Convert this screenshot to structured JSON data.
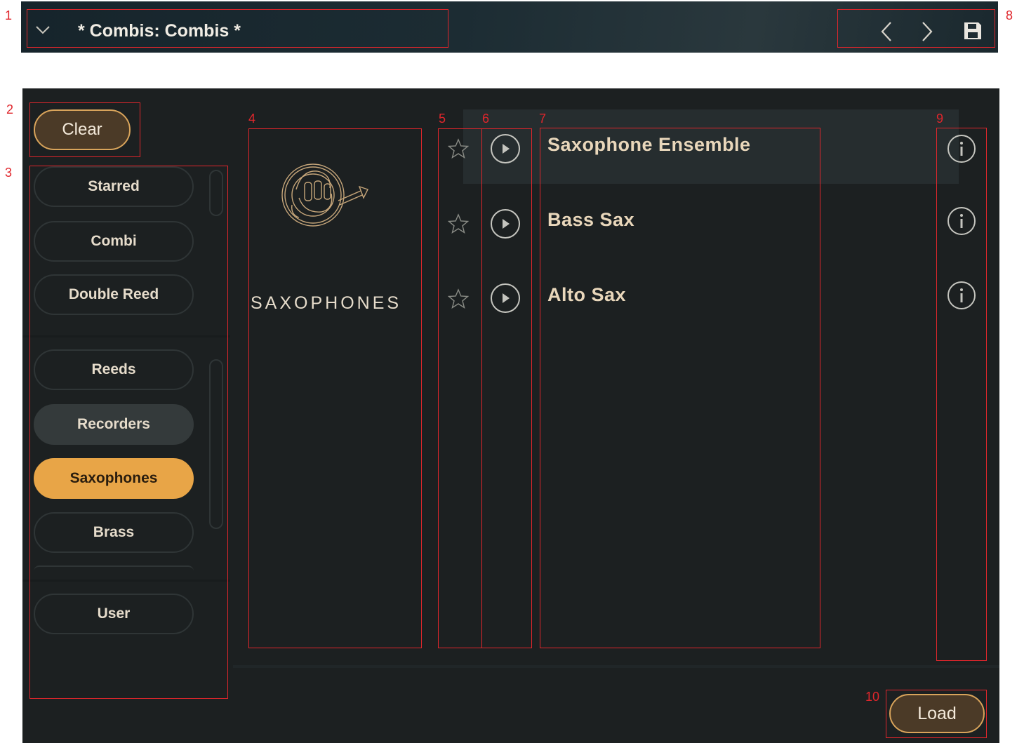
{
  "header": {
    "title": "* Combis: Combis *",
    "chevron_icon": "chevron-down-icon",
    "nav_prev_icon": "chevron-left-icon",
    "nav_next_icon": "chevron-right-icon",
    "save_icon": "floppy-disk-icon"
  },
  "toolbar": {
    "clear_label": "Clear"
  },
  "categories": {
    "top": [
      {
        "label": "Starred"
      },
      {
        "label": "Combi"
      },
      {
        "label": "Double Reed"
      }
    ],
    "groups": [
      {
        "label": "Reeds"
      },
      {
        "label": "Recorders"
      },
      {
        "label": "Saxophones"
      },
      {
        "label": "Brass"
      }
    ],
    "bottom": [
      {
        "label": "User"
      }
    ],
    "selected": "Saxophones"
  },
  "preview": {
    "title": "SAXOPHONES",
    "image_icon": "horn-icon"
  },
  "presets": [
    {
      "name": "Saxophone Ensemble"
    },
    {
      "name": "Bass Sax"
    },
    {
      "name": "Alto Sax"
    }
  ],
  "footer": {
    "load_label": "Load"
  },
  "callouts": [
    "1",
    "2",
    "3",
    "4",
    "5",
    "6",
    "7",
    "8",
    "9",
    "10"
  ],
  "colors": {
    "accent": "#e8a547",
    "panel_bg": "#1c2021",
    "text": "#e9d7bb",
    "annotation": "#e0262c"
  }
}
